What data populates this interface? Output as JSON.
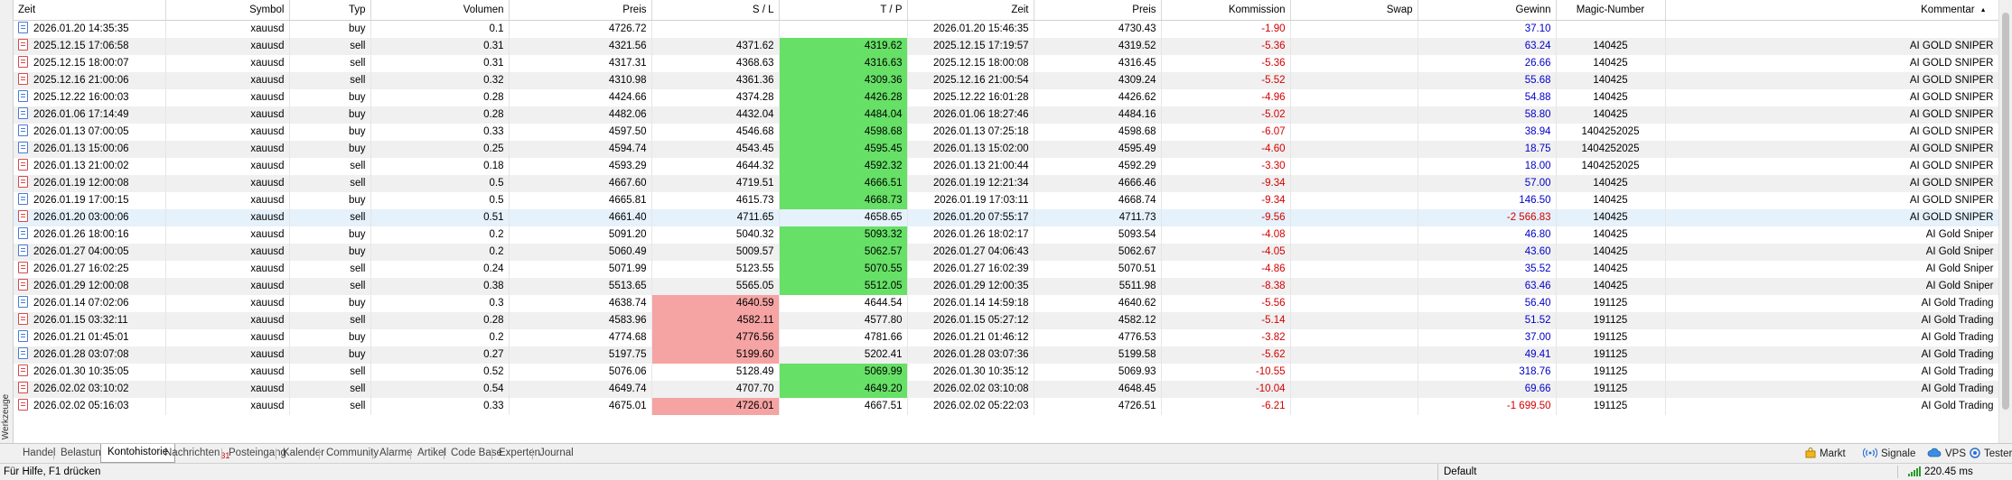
{
  "side_panel": {
    "label": "Werkzeuge"
  },
  "columns": [
    {
      "key": "time_open",
      "label": "Zeit",
      "align": "left",
      "width": 168
    },
    {
      "key": "symbol",
      "label": "Symbol",
      "align": "right",
      "width": 137
    },
    {
      "key": "type",
      "label": "Typ",
      "align": "right",
      "width": 90
    },
    {
      "key": "volume",
      "label": "Volumen",
      "align": "right",
      "width": 153
    },
    {
      "key": "price_open",
      "label": "Preis",
      "align": "right",
      "width": 158
    },
    {
      "key": "sl",
      "label": "S / L",
      "align": "right",
      "width": 141
    },
    {
      "key": "tp",
      "label": "T / P",
      "align": "right",
      "width": 142
    },
    {
      "key": "time_close",
      "label": "Zeit",
      "align": "right",
      "width": 140
    },
    {
      "key": "price_close",
      "label": "Preis",
      "align": "right",
      "width": 141
    },
    {
      "key": "commission",
      "label": "Kommission",
      "align": "right",
      "width": 143
    },
    {
      "key": "swap",
      "label": "Swap",
      "align": "right",
      "width": 141
    },
    {
      "key": "profit",
      "label": "Gewinn",
      "align": "right",
      "width": 153
    },
    {
      "key": "magic",
      "label": "Magic-Number",
      "align": "center",
      "width": 121
    },
    {
      "key": "comment",
      "label": "Kommentar",
      "align": "right",
      "width": 369
    }
  ],
  "sort_indicator": "▲",
  "rows": [
    {
      "type": "buy",
      "time_open": "2026.01.20 14:35:35",
      "symbol": "xauusd",
      "volume": "0.1",
      "price_open": "4726.72",
      "sl": "",
      "tp": "",
      "time_close": "2026.01.20 15:46:35",
      "price_close": "4730.43",
      "commission": "-1.90",
      "swap": "",
      "profit": "37.10",
      "magic": "",
      "comment": "",
      "tp_hit": false,
      "sl_hit": false
    },
    {
      "type": "sell",
      "time_open": "2025.12.15 17:06:58",
      "symbol": "xauusd",
      "volume": "0.31",
      "price_open": "4321.56",
      "sl": "4371.62",
      "tp": "4319.62",
      "time_close": "2025.12.15 17:19:57",
      "price_close": "4319.52",
      "commission": "-5.36",
      "swap": "",
      "profit": "63.24",
      "magic": "140425",
      "comment": "AI GOLD SNIPER",
      "tp_hit": true,
      "sl_hit": false
    },
    {
      "type": "sell",
      "time_open": "2025.12.15 18:00:07",
      "symbol": "xauusd",
      "volume": "0.31",
      "price_open": "4317.31",
      "sl": "4368.63",
      "tp": "4316.63",
      "time_close": "2025.12.15 18:00:08",
      "price_close": "4316.45",
      "commission": "-5.36",
      "swap": "",
      "profit": "26.66",
      "magic": "140425",
      "comment": "AI GOLD SNIPER",
      "tp_hit": true,
      "sl_hit": false
    },
    {
      "type": "sell",
      "time_open": "2025.12.16 21:00:06",
      "symbol": "xauusd",
      "volume": "0.32",
      "price_open": "4310.98",
      "sl": "4361.36",
      "tp": "4309.36",
      "time_close": "2025.12.16 21:00:54",
      "price_close": "4309.24",
      "commission": "-5.52",
      "swap": "",
      "profit": "55.68",
      "magic": "140425",
      "comment": "AI GOLD SNIPER",
      "tp_hit": true,
      "sl_hit": false
    },
    {
      "type": "buy",
      "time_open": "2025.12.22 16:00:03",
      "symbol": "xauusd",
      "volume": "0.28",
      "price_open": "4424.66",
      "sl": "4374.28",
      "tp": "4426.28",
      "time_close": "2025.12.22 16:01:28",
      "price_close": "4426.62",
      "commission": "-4.96",
      "swap": "",
      "profit": "54.88",
      "magic": "140425",
      "comment": "AI GOLD SNIPER",
      "tp_hit": true,
      "sl_hit": false
    },
    {
      "type": "buy",
      "time_open": "2026.01.06 17:14:49",
      "symbol": "xauusd",
      "volume": "0.28",
      "price_open": "4482.06",
      "sl": "4432.04",
      "tp": "4484.04",
      "time_close": "2026.01.06 18:27:46",
      "price_close": "4484.16",
      "commission": "-5.02",
      "swap": "",
      "profit": "58.80",
      "magic": "140425",
      "comment": "AI GOLD SNIPER",
      "tp_hit": true,
      "sl_hit": false
    },
    {
      "type": "buy",
      "time_open": "2026.01.13 07:00:05",
      "symbol": "xauusd",
      "volume": "0.33",
      "price_open": "4597.50",
      "sl": "4546.68",
      "tp": "4598.68",
      "time_close": "2026.01.13 07:25:18",
      "price_close": "4598.68",
      "commission": "-6.07",
      "swap": "",
      "profit": "38.94",
      "magic": "1404252025",
      "comment": "AI GOLD SNIPER",
      "tp_hit": true,
      "sl_hit": false
    },
    {
      "type": "buy",
      "time_open": "2026.01.13 15:00:06",
      "symbol": "xauusd",
      "volume": "0.25",
      "price_open": "4594.74",
      "sl": "4543.45",
      "tp": "4595.45",
      "time_close": "2026.01.13 15:02:00",
      "price_close": "4595.49",
      "commission": "-4.60",
      "swap": "",
      "profit": "18.75",
      "magic": "1404252025",
      "comment": "AI GOLD SNIPER",
      "tp_hit": true,
      "sl_hit": false
    },
    {
      "type": "sell",
      "time_open": "2026.01.13 21:00:02",
      "symbol": "xauusd",
      "volume": "0.18",
      "price_open": "4593.29",
      "sl": "4644.32",
      "tp": "4592.32",
      "time_close": "2026.01.13 21:00:44",
      "price_close": "4592.29",
      "commission": "-3.30",
      "swap": "",
      "profit": "18.00",
      "magic": "1404252025",
      "comment": "AI GOLD SNIPER",
      "tp_hit": true,
      "sl_hit": false
    },
    {
      "type": "sell",
      "time_open": "2026.01.19 12:00:08",
      "symbol": "xauusd",
      "volume": "0.5",
      "price_open": "4667.60",
      "sl": "4719.51",
      "tp": "4666.51",
      "time_close": "2026.01.19 12:21:34",
      "price_close": "4666.46",
      "commission": "-9.34",
      "swap": "",
      "profit": "57.00",
      "magic": "140425",
      "comment": "AI GOLD SNIPER",
      "tp_hit": true,
      "sl_hit": false
    },
    {
      "type": "buy",
      "time_open": "2026.01.19 17:00:15",
      "symbol": "xauusd",
      "volume": "0.5",
      "price_open": "4665.81",
      "sl": "4615.73",
      "tp": "4668.73",
      "time_close": "2026.01.19 17:03:11",
      "price_close": "4668.74",
      "commission": "-9.34",
      "swap": "",
      "profit": "146.50",
      "magic": "140425",
      "comment": "AI GOLD SNIPER",
      "tp_hit": true,
      "sl_hit": false
    },
    {
      "type": "sell",
      "time_open": "2026.01.20 03:00:06",
      "symbol": "xauusd",
      "volume": "0.51",
      "price_open": "4661.40",
      "sl": "4711.65",
      "tp": "4658.65",
      "time_close": "2026.01.20 07:55:17",
      "price_close": "4711.73",
      "commission": "-9.56",
      "swap": "",
      "profit": "-2 566.83",
      "magic": "140425",
      "comment": "AI GOLD SNIPER",
      "tp_hit": false,
      "sl_hit": false,
      "selected": true
    },
    {
      "type": "buy",
      "time_open": "2026.01.26 18:00:16",
      "symbol": "xauusd",
      "volume": "0.2",
      "price_open": "5091.20",
      "sl": "5040.32",
      "tp": "5093.32",
      "time_close": "2026.01.26 18:02:17",
      "price_close": "5093.54",
      "commission": "-4.08",
      "swap": "",
      "profit": "46.80",
      "magic": "140425",
      "comment": "AI Gold Sniper",
      "tp_hit": true,
      "sl_hit": false
    },
    {
      "type": "buy",
      "time_open": "2026.01.27 04:00:05",
      "symbol": "xauusd",
      "volume": "0.2",
      "price_open": "5060.49",
      "sl": "5009.57",
      "tp": "5062.57",
      "time_close": "2026.01.27 04:06:43",
      "price_close": "5062.67",
      "commission": "-4.05",
      "swap": "",
      "profit": "43.60",
      "magic": "140425",
      "comment": "AI Gold Sniper",
      "tp_hit": true,
      "sl_hit": false
    },
    {
      "type": "sell",
      "time_open": "2026.01.27 16:02:25",
      "symbol": "xauusd",
      "volume": "0.24",
      "price_open": "5071.99",
      "sl": "5123.55",
      "tp": "5070.55",
      "time_close": "2026.01.27 16:02:39",
      "price_close": "5070.51",
      "commission": "-4.86",
      "swap": "",
      "profit": "35.52",
      "magic": "140425",
      "comment": "AI Gold Sniper",
      "tp_hit": true,
      "sl_hit": false
    },
    {
      "type": "sell",
      "time_open": "2026.01.29 12:00:08",
      "symbol": "xauusd",
      "volume": "0.38",
      "price_open": "5513.65",
      "sl": "5565.05",
      "tp": "5512.05",
      "time_close": "2026.01.29 12:00:35",
      "price_close": "5511.98",
      "commission": "-8.38",
      "swap": "",
      "profit": "63.46",
      "magic": "140425",
      "comment": "AI Gold Sniper",
      "tp_hit": true,
      "sl_hit": false
    },
    {
      "type": "buy",
      "time_open": "2026.01.14 07:02:06",
      "symbol": "xauusd",
      "volume": "0.3",
      "price_open": "4638.74",
      "sl": "4640.59",
      "tp": "4644.54",
      "time_close": "2026.01.14 14:59:18",
      "price_close": "4640.62",
      "commission": "-5.56",
      "swap": "",
      "profit": "56.40",
      "magic": "191125",
      "comment": "AI Gold Trading",
      "tp_hit": false,
      "sl_hit": true
    },
    {
      "type": "sell",
      "time_open": "2026.01.15 03:32:11",
      "symbol": "xauusd",
      "volume": "0.28",
      "price_open": "4583.96",
      "sl": "4582.11",
      "tp": "4577.80",
      "time_close": "2026.01.15 05:27:12",
      "price_close": "4582.12",
      "commission": "-5.14",
      "swap": "",
      "profit": "51.52",
      "magic": "191125",
      "comment": "AI Gold Trading",
      "tp_hit": false,
      "sl_hit": true
    },
    {
      "type": "buy",
      "time_open": "2026.01.21 01:45:01",
      "symbol": "xauusd",
      "volume": "0.2",
      "price_open": "4774.68",
      "sl": "4776.56",
      "tp": "4781.66",
      "time_close": "2026.01.21 01:46:12",
      "price_close": "4776.53",
      "commission": "-3.82",
      "swap": "",
      "profit": "37.00",
      "magic": "191125",
      "comment": "AI Gold Trading",
      "tp_hit": false,
      "sl_hit": true
    },
    {
      "type": "buy",
      "time_open": "2026.01.28 03:07:08",
      "symbol": "xauusd",
      "volume": "0.27",
      "price_open": "5197.75",
      "sl": "5199.60",
      "tp": "5202.41",
      "time_close": "2026.01.28 03:07:36",
      "price_close": "5199.58",
      "commission": "-5.62",
      "swap": "",
      "profit": "49.41",
      "magic": "191125",
      "comment": "AI Gold Trading",
      "tp_hit": false,
      "sl_hit": true
    },
    {
      "type": "sell",
      "time_open": "2026.01.30 10:35:05",
      "symbol": "xauusd",
      "volume": "0.52",
      "price_open": "5076.06",
      "sl": "5128.49",
      "tp": "5069.99",
      "time_close": "2026.01.30 10:35:12",
      "price_close": "5069.93",
      "commission": "-10.55",
      "swap": "",
      "profit": "318.76",
      "magic": "191125",
      "comment": "AI Gold Trading",
      "tp_hit": true,
      "sl_hit": false
    },
    {
      "type": "sell",
      "time_open": "2026.02.02 03:10:02",
      "symbol": "xauusd",
      "volume": "0.54",
      "price_open": "4649.74",
      "sl": "4707.70",
      "tp": "4649.20",
      "time_close": "2026.02.02 03:10:08",
      "price_close": "4648.45",
      "commission": "-10.04",
      "swap": "",
      "profit": "69.66",
      "magic": "191125",
      "comment": "AI Gold Trading",
      "tp_hit": true,
      "sl_hit": false
    },
    {
      "type": "sell",
      "time_open": "2026.02.02 05:16:03",
      "symbol": "xauusd",
      "volume": "0.33",
      "price_open": "4675.01",
      "sl": "4726.01",
      "tp": "4667.51",
      "time_close": "2026.02.02 05:22:03",
      "price_close": "4726.51",
      "commission": "-6.21",
      "swap": "",
      "profit": "-1 699.50",
      "magic": "191125",
      "comment": "AI Gold Trading",
      "tp_hit": false,
      "sl_hit": true
    }
  ],
  "tabs": [
    {
      "label": "Handel",
      "active": false
    },
    {
      "label": "Belastung",
      "active": false
    },
    {
      "label": "Kontohistorie",
      "active": true
    },
    {
      "label": "Nachrichten",
      "active": false,
      "badge": "31"
    },
    {
      "label": "Posteingang",
      "active": false
    },
    {
      "label": "Kalender",
      "active": false
    },
    {
      "label": "Community",
      "active": false
    },
    {
      "label": "Alarme",
      "active": false
    },
    {
      "label": "Artikel",
      "active": false
    },
    {
      "label": "Code Base",
      "active": false
    },
    {
      "label": "Experten",
      "active": false
    },
    {
      "label": "Journal",
      "active": false
    }
  ],
  "right_tabs": [
    {
      "label": "Markt",
      "icon": "market-bag-icon"
    },
    {
      "label": "Signale",
      "icon": "signal-icon"
    },
    {
      "label": "VPS",
      "icon": "cloud-icon"
    },
    {
      "label": "Tester",
      "icon": "tester-icon"
    }
  ],
  "status": {
    "help": "Für Hilfe, F1 drücken",
    "profile": "Default",
    "ping": "220.45 ms"
  },
  "colors": {
    "tp_hit": "#66e066",
    "sl_hit": "#f5a3a3",
    "negative": "#d40000",
    "positive_profit": "#0000c8",
    "selected_row": "#e5f1fb"
  }
}
